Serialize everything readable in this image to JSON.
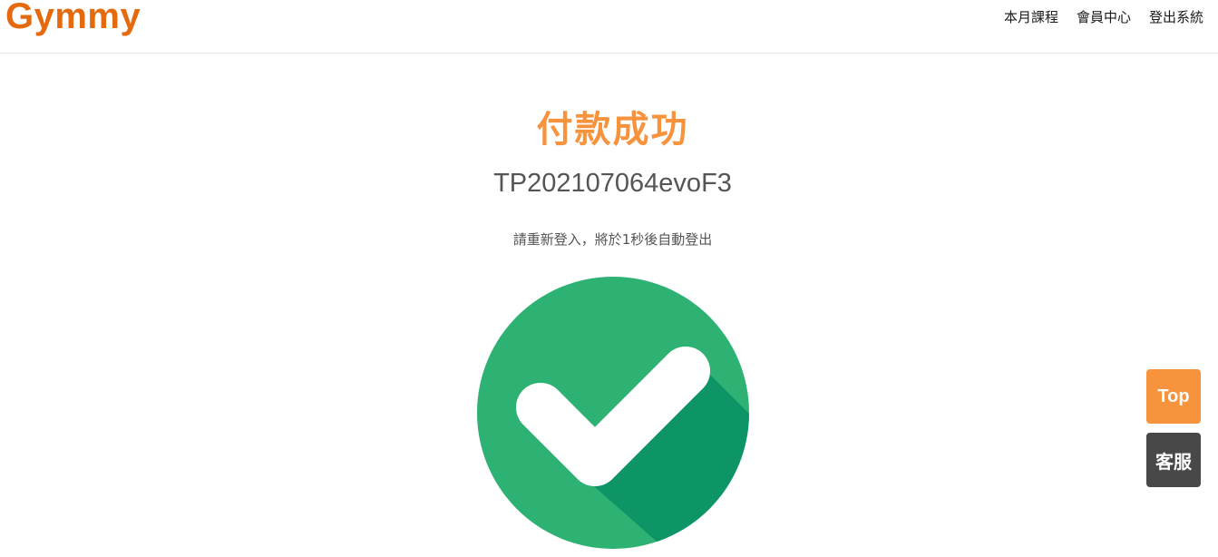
{
  "header": {
    "logo": "Gymmy",
    "nav": [
      {
        "label": "本月課程"
      },
      {
        "label": "會員中心"
      },
      {
        "label": "登出系統"
      }
    ]
  },
  "main": {
    "title": "付款成功",
    "order_id": "TP202107064evoF3",
    "notice": "請重新登入，將於1秒後自動登出",
    "status_icon": "check-circle-icon"
  },
  "floating": {
    "top_label": "Top",
    "service_label": "客服"
  },
  "colors": {
    "brand": "#e46a0d",
    "accent": "#f7923d",
    "success": "#2eb273",
    "success_dark": "#0e9566",
    "dark_button": "#484848"
  }
}
